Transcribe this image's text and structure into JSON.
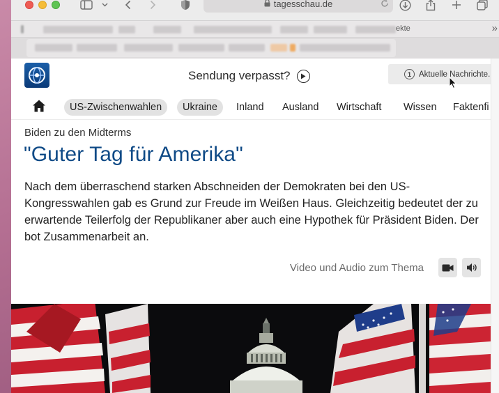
{
  "browser": {
    "url": "tagesschau.de",
    "bookmark_visible_text": "ekte"
  },
  "header": {
    "missed_label": "Sendung verpasst?",
    "news_button_label": "Aktuelle Nachrichte..."
  },
  "nav": {
    "items": [
      {
        "label": "US-Zwischenwahlen",
        "highlighted": true
      },
      {
        "label": "Ukraine",
        "highlighted": true
      },
      {
        "label": "Inland",
        "highlighted": false
      },
      {
        "label": "Ausland",
        "highlighted": false
      },
      {
        "label": "Wirtschaft",
        "highlighted": false
      },
      {
        "label": "Wissen",
        "highlighted": false
      },
      {
        "label": "Faktenfi",
        "highlighted": false
      }
    ]
  },
  "article": {
    "kicker": "Biden zu den Midterms",
    "headline": "\"Guter Tag für Amerika\"",
    "teaser": "Nach dem überraschend starken Abschneiden der Demokraten bei den US-Kongresswahlen gab es Grund zur Freude im Weißen Haus. Gleichzeitig bedeutet der zu erwartende Teilerfolg der Republikaner aber auch eine Hypothek für Präsident Biden. Der bot Zusammenarbeit an.",
    "media_label": "Video und Audio zum Thema"
  },
  "icons": {
    "sidebar": "sidebar-icon",
    "back": "chevron-left-icon",
    "forward": "chevron-right-icon",
    "shield": "shield-icon",
    "lock": "lock-icon",
    "reload": "reload-icon",
    "download": "download-icon",
    "share": "share-icon",
    "new_tab": "plus-icon",
    "tabs": "tabs-overview-icon",
    "home": "home-icon",
    "play": "play-icon",
    "video": "video-camera-icon",
    "audio": "speaker-icon"
  },
  "colors": {
    "headline": "#0f4a86",
    "logo": "#1b5fa8",
    "pill": "#e2e2e2"
  }
}
